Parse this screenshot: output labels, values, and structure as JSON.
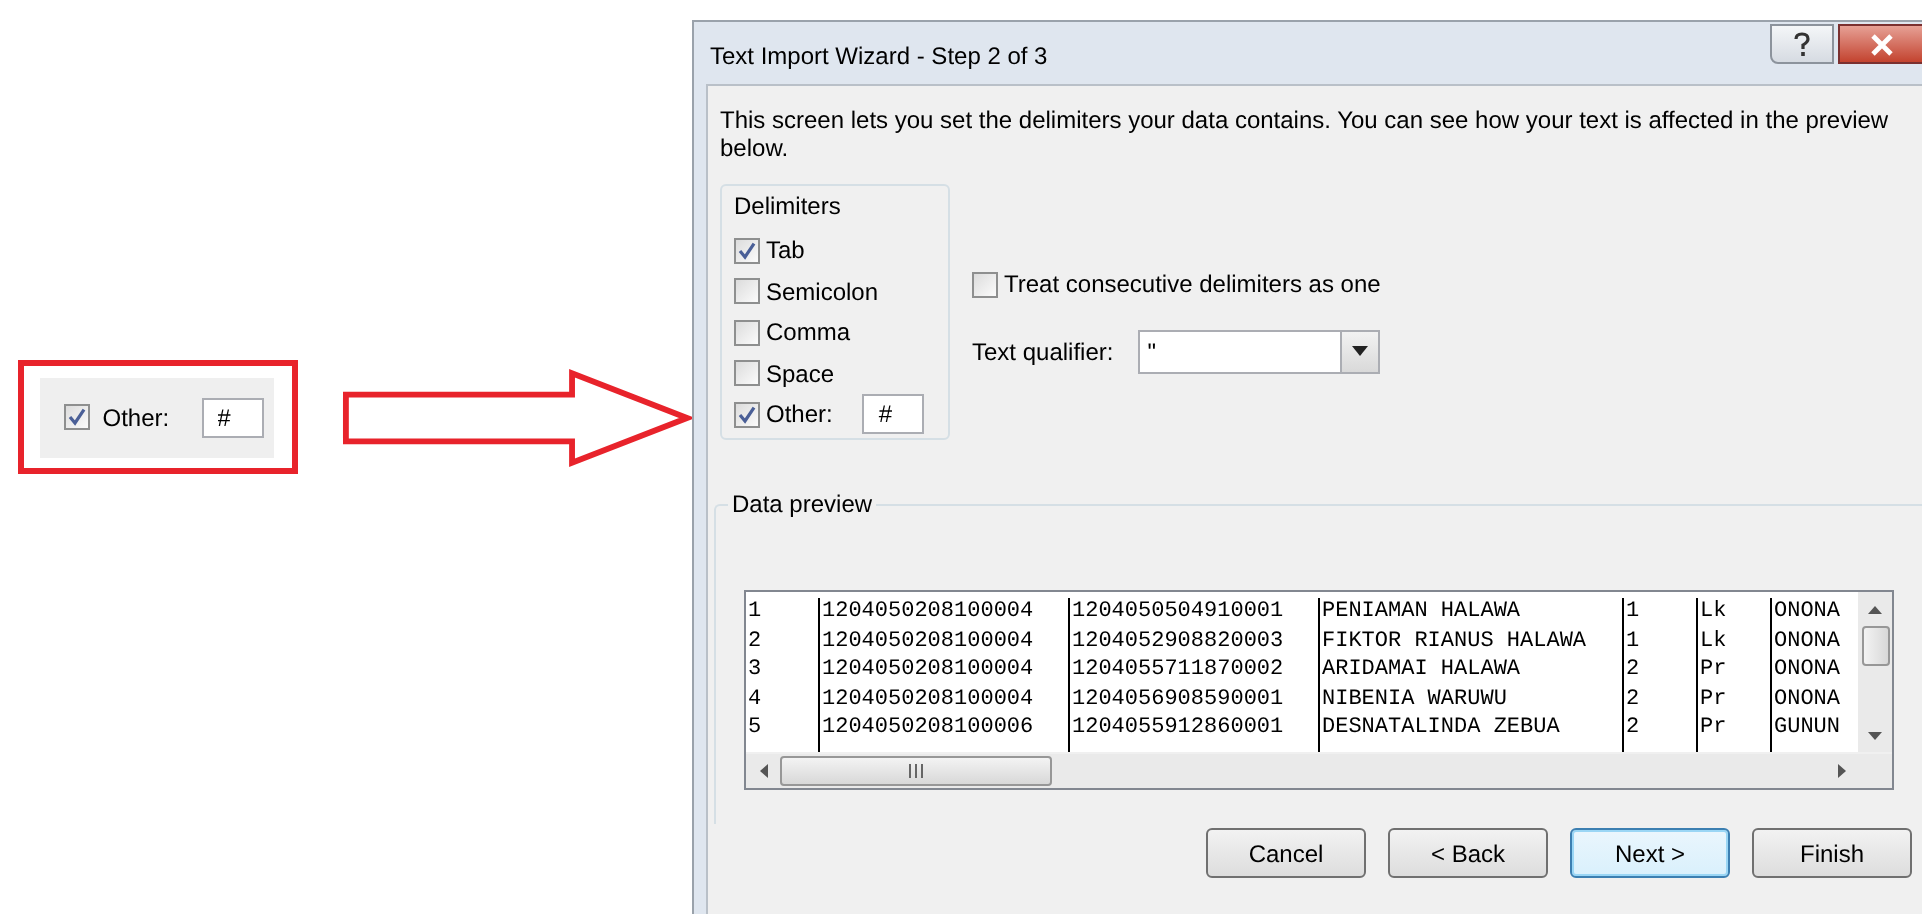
{
  "callout": {
    "checked": true,
    "label": "Other:",
    "value": "#"
  },
  "window": {
    "title": "Text Import Wizard - Step 2 of 3"
  },
  "description": "This screen lets you set the delimiters your data contains.  You can see how your text is affected in the preview below.",
  "delimiters": {
    "title": "Delimiters",
    "items": [
      {
        "label": "Tab",
        "checked": true
      },
      {
        "label": "Semicolon",
        "checked": false
      },
      {
        "label": "Comma",
        "checked": false
      },
      {
        "label": "Space",
        "checked": false
      },
      {
        "label": "Other:",
        "checked": true,
        "value": "#"
      }
    ]
  },
  "treat_consecutive": {
    "label": "Treat consecutive delimiters as one",
    "checked": false
  },
  "text_qualifier": {
    "label": "Text qualifier:",
    "value": "\""
  },
  "data_preview": {
    "title": "Data preview",
    "rows": [
      [
        "1",
        "1204050208100004",
        "1204050504910001",
        "PENIAMAN HALAWA",
        "1",
        "Lk",
        "ONONA"
      ],
      [
        "2",
        "1204050208100004",
        "1204052908820003",
        "FIKTOR RIANUS HALAWA",
        "1",
        "Lk",
        "ONONA"
      ],
      [
        "3",
        "1204050208100004",
        "1204055711870002",
        "ARIDAMAI HALAWA",
        "2",
        "Pr",
        "ONONA"
      ],
      [
        "4",
        "1204050208100004",
        "1204056908590001",
        "NIBENIA WARUWU",
        "2",
        "Pr",
        "ONONA"
      ],
      [
        "5",
        "1204050208100006",
        "1204055912860001",
        "DESNATALINDA ZEBUA",
        "2",
        "Pr",
        "GUNUN"
      ]
    ]
  },
  "buttons": [
    {
      "label": "Cancel",
      "default": false
    },
    {
      "label": "< Back",
      "default": false
    },
    {
      "label": "Next >",
      "default": true
    },
    {
      "label": "Finish",
      "default": false
    }
  ]
}
